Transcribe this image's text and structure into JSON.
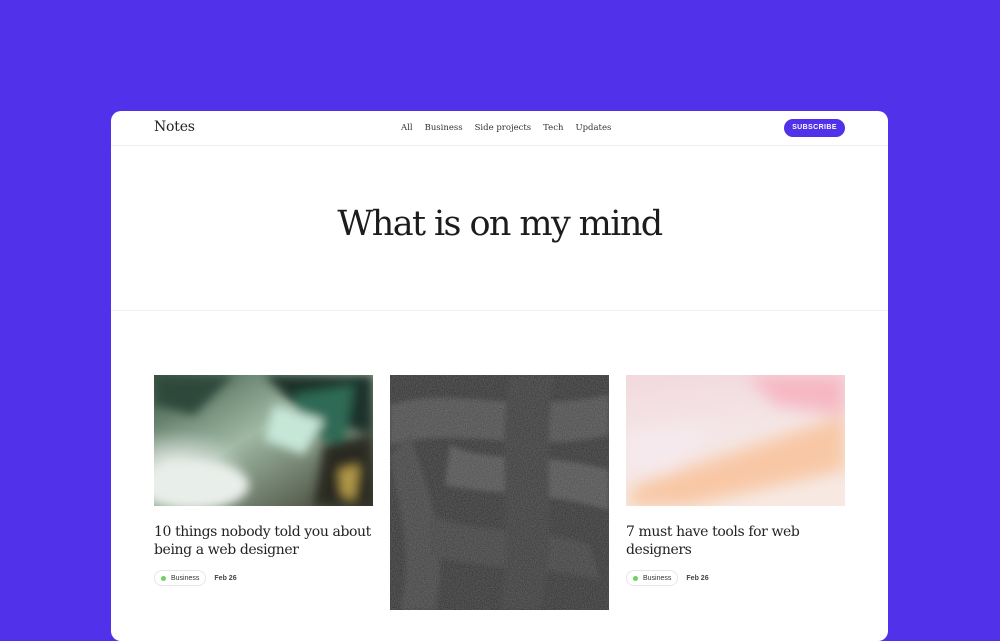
{
  "app": {
    "brand": "Notes",
    "subscribe_label": "SUBSCRIBE",
    "accent_color": "#5131EA"
  },
  "nav": {
    "items": [
      "All",
      "Business",
      "Side projects",
      "Tech",
      "Updates"
    ]
  },
  "hero": {
    "title": "What is on my mind"
  },
  "posts": [
    {
      "title": "10 things nobody told you about being a web designer",
      "tag": "Business",
      "date": "Feb 26",
      "image": "green-crystal-abstract"
    },
    {
      "title": "",
      "image": "dark-charcoal-brush-texture"
    },
    {
      "title": "7 must have tools for web designers",
      "tag": "Business",
      "date": "Feb 26",
      "image": "pink-peach-gradient"
    }
  ],
  "tag_dot_color": "#6FD160"
}
